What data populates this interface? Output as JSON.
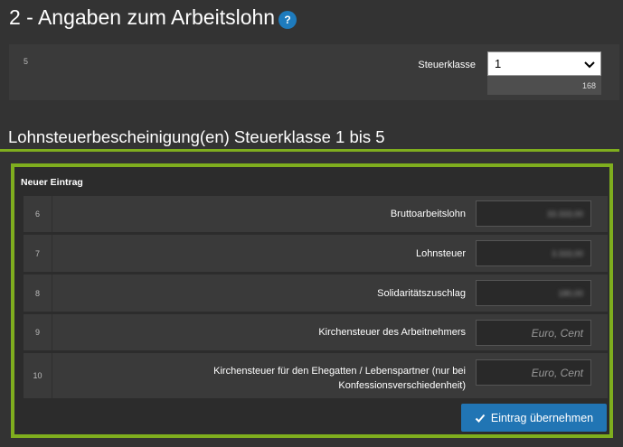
{
  "section": {
    "title": "2 - Angaben zum Arbeitslohn",
    "help_icon": "?"
  },
  "top_row": {
    "number": "5",
    "label": "Steuerklasse",
    "select_value": "1",
    "sub_value": "168"
  },
  "sub_section": {
    "title": "Lohnsteuerbescheinigung(en) Steuerklasse 1 bis 5"
  },
  "entry": {
    "title": "Neuer Eintrag",
    "rows": [
      {
        "number": "6",
        "label": "Bruttoarbeitslohn",
        "value": "33.333,00",
        "placeholder": ""
      },
      {
        "number": "7",
        "label": "Lohnsteuer",
        "value": "3.333,00",
        "placeholder": ""
      },
      {
        "number": "8",
        "label": "Solidaritätszuschlag",
        "value": "180,00",
        "placeholder": ""
      },
      {
        "number": "9",
        "label": "Kirchensteuer des Arbeitnehmers",
        "value": "",
        "placeholder": "Euro, Cent"
      },
      {
        "number": "10",
        "label_line1": "Kirchensteuer für den Ehegatten / Lebenspartner (nur bei",
        "label_line2": "Konfessionsverschiedenheit)",
        "value": "",
        "placeholder": "Euro, Cent"
      }
    ],
    "submit_label": "Eintrag übernehmen"
  },
  "colors": {
    "accent_green": "#7fae1e",
    "button_blue": "#2175b4",
    "help_blue": "#1e7bbd"
  }
}
